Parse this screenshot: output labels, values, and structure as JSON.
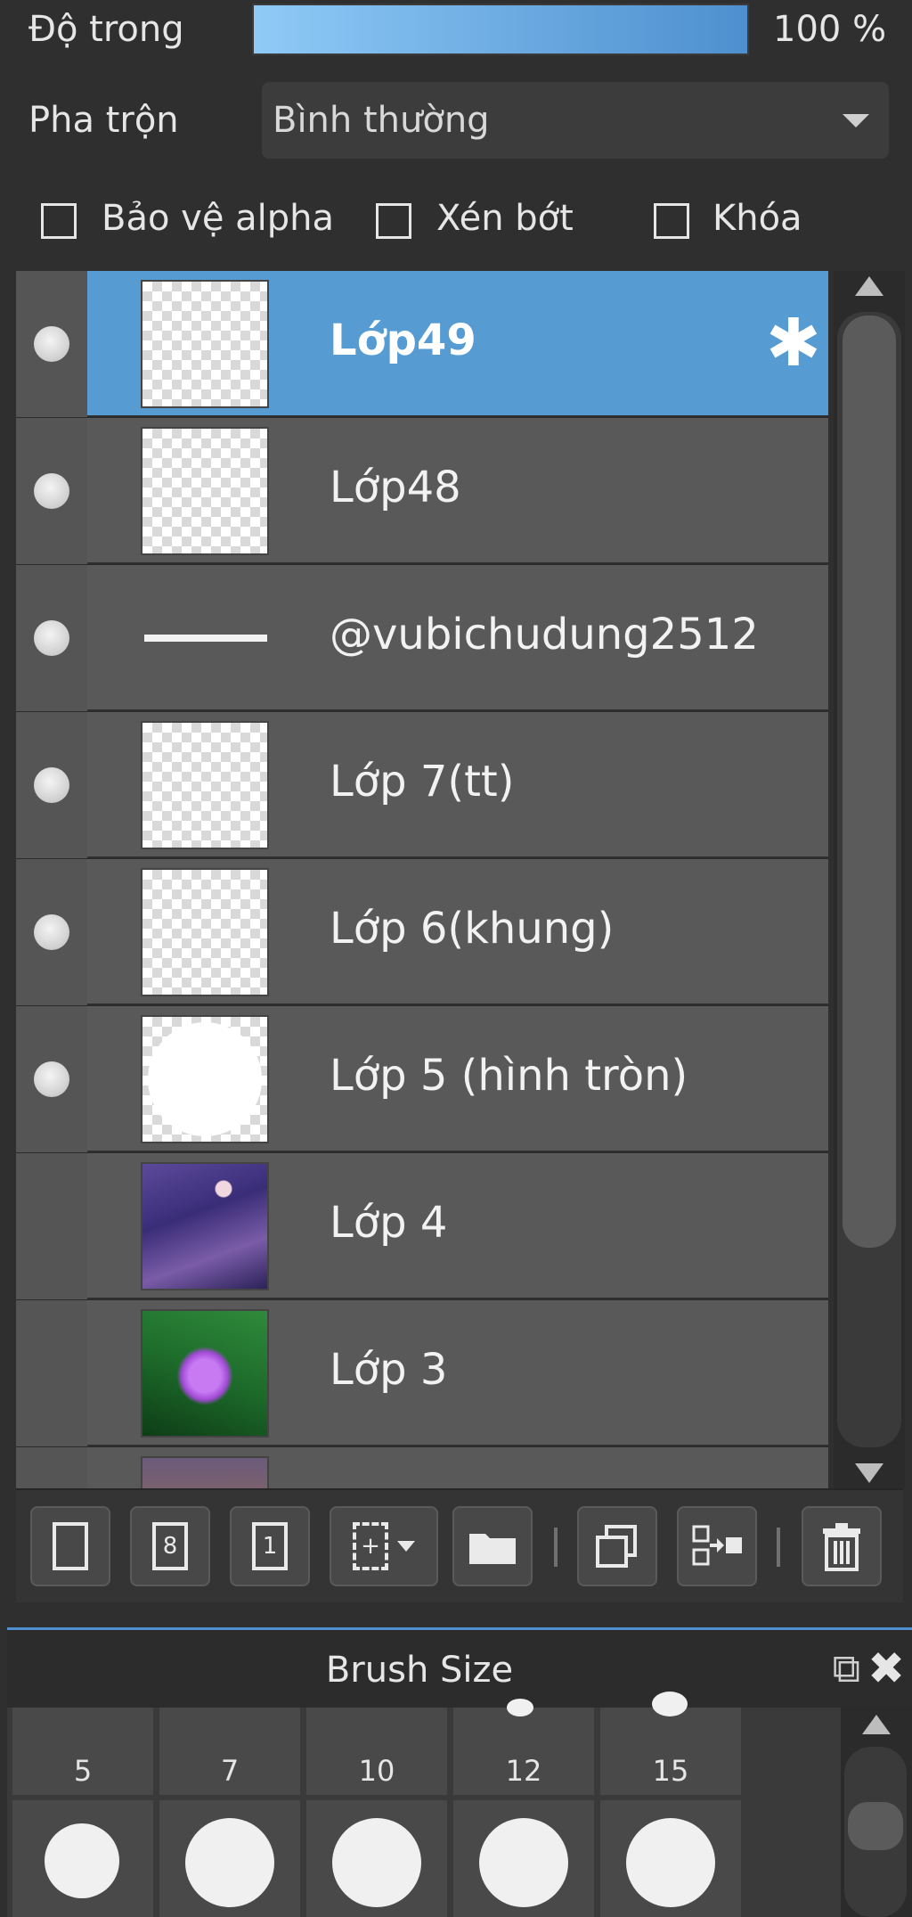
{
  "opacity": {
    "label": "Độ trong",
    "value_text": "100 %",
    "value": 100
  },
  "blend": {
    "label": "Pha trộn",
    "selected": "Bình thường"
  },
  "checkboxes": [
    {
      "label": "Bảo vệ alpha",
      "checked": false
    },
    {
      "label": "Xén bớt",
      "checked": false
    },
    {
      "label": "Khóa",
      "checked": false
    }
  ],
  "layers": [
    {
      "name": "Lớp49",
      "selected": true,
      "visible": true,
      "thumb": "transparent",
      "has_settings_icon": true
    },
    {
      "name": "Lớp48",
      "selected": false,
      "visible": true,
      "thumb": "transparent"
    },
    {
      "name": "@vubichudung2512",
      "selected": false,
      "visible": true,
      "thumb": "text"
    },
    {
      "name": "Lớp 7(tt)",
      "selected": false,
      "visible": true,
      "thumb": "transparent"
    },
    {
      "name": "Lớp 6(khung)",
      "selected": false,
      "visible": true,
      "thumb": "transparent"
    },
    {
      "name": "Lớp 5 (hình tròn)",
      "selected": false,
      "visible": true,
      "thumb": "circle"
    },
    {
      "name": "Lớp 4",
      "selected": false,
      "visible": false,
      "thumb": "photo"
    },
    {
      "name": "Lớp 3",
      "selected": false,
      "visible": false,
      "thumb": "photo"
    }
  ],
  "toolbar": {
    "buttons": [
      {
        "icon": "new-layer-icon",
        "glyph": ""
      },
      {
        "icon": "new-8bit-layer-icon",
        "glyph": "8"
      },
      {
        "icon": "new-1bit-layer-icon",
        "glyph": "1"
      },
      {
        "icon": "add-layer-menu-icon",
        "glyph": "+"
      },
      {
        "icon": "folder-icon",
        "glyph": ""
      },
      {
        "icon": "duplicate-layer-icon",
        "glyph": ""
      },
      {
        "icon": "merge-layer-icon",
        "glyph": ""
      },
      {
        "icon": "trash-icon",
        "glyph": ""
      }
    ]
  },
  "brush_panel": {
    "title": "Brush Size",
    "sizes": [
      "5",
      "7",
      "10",
      "12",
      "15"
    ]
  },
  "colors": {
    "accent": "#579bd3",
    "panel": "#595959",
    "background": "#2f2f2f"
  }
}
